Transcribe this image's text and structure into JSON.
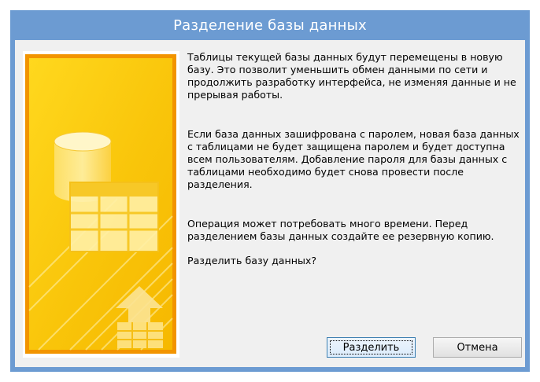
{
  "dialog": {
    "title": "Разделение базы данных",
    "paragraphs": {
      "p1": "Таблицы текущей базы данных будут перемещены в новую базу.  Это позволит уменьшить обмен данными по сети и продолжить разработку интерфейса, не изменяя данные и не прерывая работы.",
      "p2": "Если база данных зашифрована с паролем, новая база данных с таблицами не будет защищена паролем и будет доступна всем пользователям. Добавление пароля для базы данных с таблицами необходимо будет снова провести после разделения.",
      "p3": "Операция может потребовать много времени. Перед разделением базы данных создайте ее резервную копию.",
      "p4": "Разделить базу данных?"
    },
    "buttons": {
      "split": "Разделить",
      "cancel": "Отмена"
    }
  },
  "illustration": {
    "icons": [
      "database-icon",
      "table-icon",
      "upload-arrow-icon"
    ],
    "colors": {
      "background": "#f8c40a",
      "highlight": "#fde98a",
      "border": "#f08a00",
      "title_bar": "#6c9bd2",
      "window_bg": "#f0f0f0"
    }
  }
}
